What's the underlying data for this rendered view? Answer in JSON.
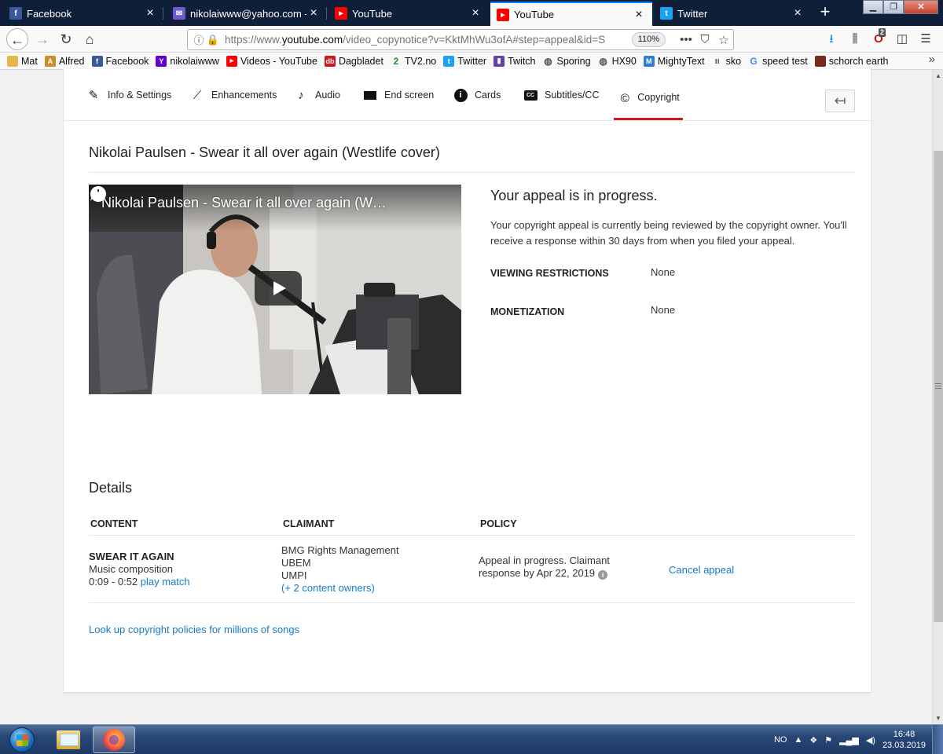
{
  "browser": {
    "tabs": [
      {
        "label": "Facebook",
        "icon": "facebook-icon",
        "color": "#3b5998",
        "glyph": "f"
      },
      {
        "label": "nikolaiwww@yahoo.com - Yahoo",
        "icon": "mail-icon",
        "color": "#6d5acd",
        "glyph": "✉"
      },
      {
        "label": "YouTube",
        "icon": "youtube-icon",
        "color": "#ff0000",
        "glyph": "▶"
      },
      {
        "label": "YouTube",
        "icon": "youtube-icon",
        "color": "#ff0000",
        "glyph": "▶"
      },
      {
        "label": "Twitter",
        "icon": "twitter-icon",
        "color": "#1da1f2",
        "glyph": "t"
      }
    ],
    "active_tab_index": 3,
    "url_prefix": "https://www.",
    "url_domain": "youtube.com",
    "url_rest": "/video_copynotice?v=KktMhWu3ofA#step=appeal&id=S",
    "zoom": "110%",
    "library_badge": "2",
    "bookmarks": [
      {
        "label": "Mat",
        "icon": "folder-icon",
        "color": "#e8b64c"
      },
      {
        "label": "Alfred",
        "icon": "butler-icon",
        "color": "#c7902b"
      },
      {
        "label": "Facebook",
        "icon": "facebook-icon",
        "color": "#3b5998"
      },
      {
        "label": "nikolaiwww",
        "icon": "yahoo-icon",
        "color": "#5f01d1"
      },
      {
        "label": "Videos - YouTube",
        "icon": "youtube-icon",
        "color": "#ff0000"
      },
      {
        "label": "Dagbladet",
        "icon": "dagbladet-icon",
        "color": "#d4161c"
      },
      {
        "label": "TV2.no",
        "icon": "tv2-icon",
        "color": "#1f8a3b"
      },
      {
        "label": "Twitter",
        "icon": "twitter-icon",
        "color": "#1da1f2"
      },
      {
        "label": "Twitch",
        "icon": "twitch-icon",
        "color": "#6441a5"
      },
      {
        "label": "Sporing",
        "icon": "globe-icon",
        "color": "#555555"
      },
      {
        "label": "HX90",
        "icon": "globe-icon",
        "color": "#555555"
      },
      {
        "label": "MightyText",
        "icon": "mightytext-icon",
        "color": "#2f7fd8"
      },
      {
        "label": "sko",
        "icon": "bars-icon",
        "color": "#555555"
      },
      {
        "label": "speed test",
        "icon": "google-icon",
        "color": "#4285f4"
      },
      {
        "label": "schorch earth",
        "icon": "image-icon",
        "color": "#7a2b1c"
      }
    ]
  },
  "studio": {
    "tabs": [
      {
        "label": "Info & Settings",
        "icon": "pencil-icon",
        "glyph": "✎"
      },
      {
        "label": "Enhancements",
        "icon": "magic-wand-icon",
        "glyph": "✨"
      },
      {
        "label": "Audio",
        "icon": "music-note-icon",
        "glyph": "♪"
      },
      {
        "label": "End screen",
        "icon": "end-screen-icon",
        "glyph": "▬"
      },
      {
        "label": "Cards",
        "icon": "info-circle-icon",
        "glyph": "ⓘ"
      },
      {
        "label": "Subtitles/CC",
        "icon": "cc-icon",
        "glyph": "CC"
      },
      {
        "label": "Copyright",
        "icon": "copyright-icon",
        "glyph": "©"
      }
    ],
    "active_tab": "Copyright",
    "video_title": "Nikolai Paulsen - Swear it all over again (Westlife cover)",
    "player_title": "Nikolai Paulsen - Swear it all over again (Westlife cover)",
    "appeal": {
      "heading": "Your appeal is in progress.",
      "description": "Your copyright appeal is currently being reviewed by the copyright owner. You'll receive a response within 30 days from when you filed your appeal.",
      "viewing_label": "VIEWING RESTRICTIONS",
      "viewing_value": "None",
      "monetization_label": "MONETIZATION",
      "monetization_value": "None"
    },
    "details": {
      "heading": "Details",
      "col_content": "CONTENT",
      "col_claimant": "CLAIMANT",
      "col_policy": "POLICY",
      "row": {
        "content_title": "SWEAR IT AGAIN",
        "content_type": "Music composition",
        "content_time": "0:09 - 0:52",
        "play_match": "play match",
        "claimants": [
          "BMG Rights Management",
          "UBEM",
          "UMPI"
        ],
        "more_owners": "(+ 2 content owners)",
        "policy_line1": "Appeal in progress. Claimant",
        "policy_line2": "response by Apr 22, 2019",
        "action": "Cancel appeal"
      },
      "lookup_link": "Look up copyright policies for millions of songs"
    }
  },
  "taskbar": {
    "language": "NO",
    "time": "16:48",
    "date": "23.03.2019"
  }
}
